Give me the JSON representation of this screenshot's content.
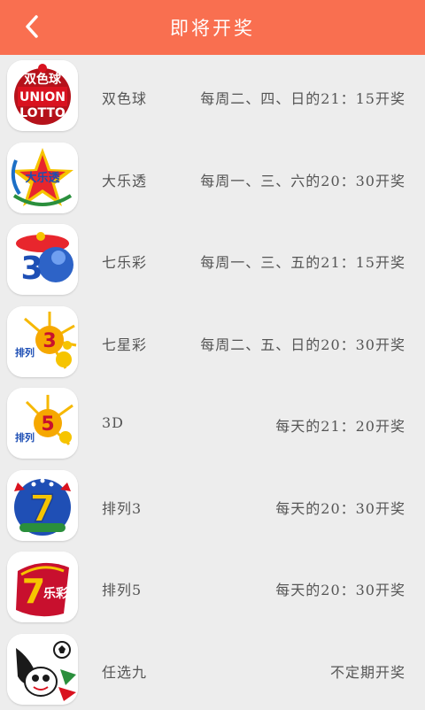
{
  "header": {
    "title": "即将开奖",
    "background": "#f96f50"
  },
  "lotteries": [
    {
      "name": "双色球",
      "schedule": "每周二、四、日的21：15开奖",
      "icon": "union-lotto-icon"
    },
    {
      "name": "大乐透",
      "schedule": "每周一、三、六的20：30开奖",
      "icon": "daletou-icon"
    },
    {
      "name": "七乐彩",
      "schedule": "每周一、三、五的21：15开奖",
      "icon": "qilecai-icon"
    },
    {
      "name": "七星彩",
      "schedule": "每周二、五、日的20：30开奖",
      "icon": "qixingcai-icon"
    },
    {
      "name": "3D",
      "schedule": "每天的21：20开奖",
      "icon": "3d-icon"
    },
    {
      "name": "排列3",
      "schedule": "每天的20：30开奖",
      "icon": "pailie3-icon"
    },
    {
      "name": "排列5",
      "schedule": "每天的20：30开奖",
      "icon": "pailie5-icon"
    },
    {
      "name": "任选九",
      "schedule": "不定期开奖",
      "icon": "renxuanjiu-icon"
    }
  ]
}
